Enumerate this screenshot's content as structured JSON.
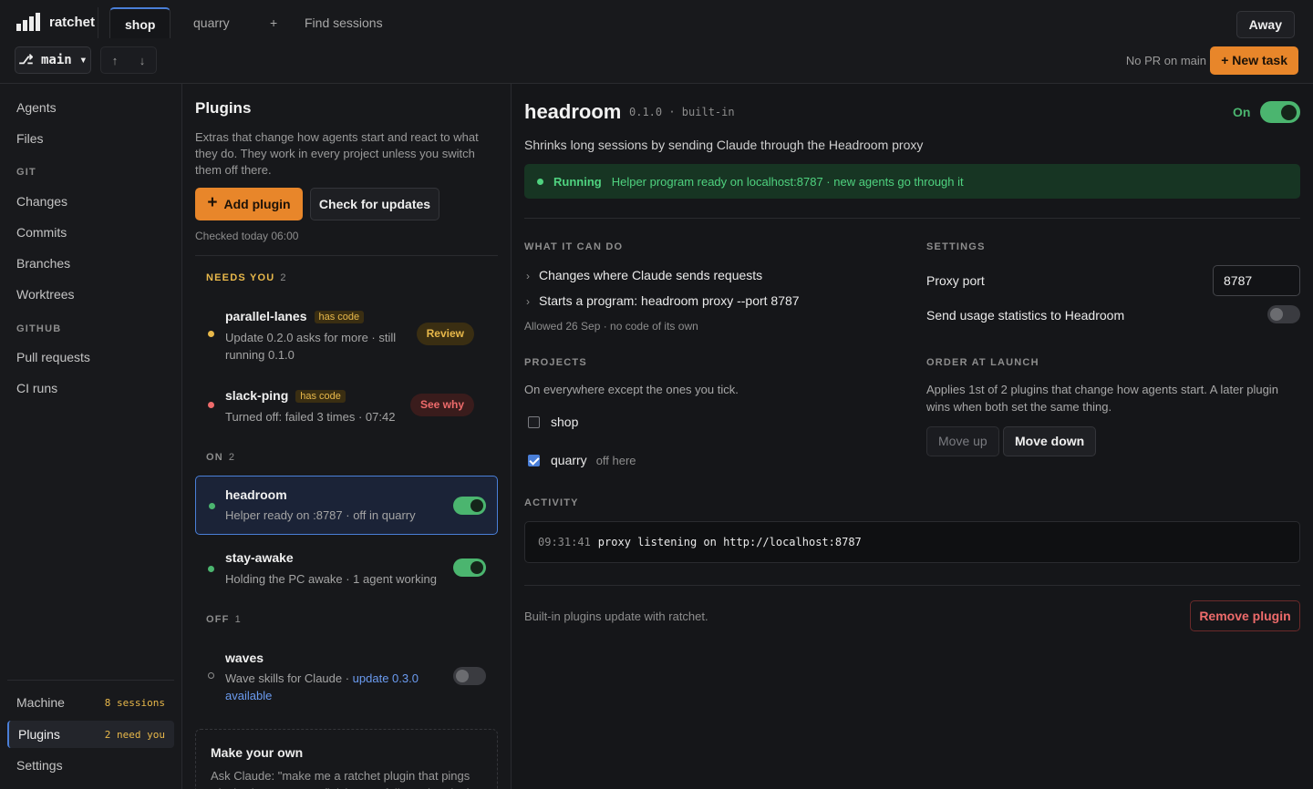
{
  "app": {
    "name": "ratchet"
  },
  "topbar": {
    "tabs": [
      {
        "label": "shop",
        "active": true
      },
      {
        "label": "quarry",
        "active": false
      },
      {
        "label": "+",
        "active": false
      },
      {
        "label": "Find sessions",
        "active": false
      }
    ],
    "status_button": "Away",
    "branch": "⎇ main ▾",
    "pr_status": "No PR on main",
    "new_task_label": "+ New task"
  },
  "sidebar": {
    "items_top": [
      "Agents",
      "Files"
    ],
    "git_heading": "GIT",
    "git_items": [
      "Changes",
      "Commits",
      "Branches",
      "Worktrees"
    ],
    "github_heading": "GITHUB",
    "github_items": [
      "Pull requests",
      "CI runs"
    ],
    "bottom": [
      {
        "label": "Machine",
        "count": "8 sessions",
        "active": false
      },
      {
        "label": "Plugins",
        "count": "2 need you",
        "active": true
      },
      {
        "label": "Settings",
        "count": "",
        "active": false
      }
    ]
  },
  "plugins_list": {
    "title": "Plugins",
    "description": "Extras that change how agents start and react to what they do. They work in every project unless you switch them off there.",
    "add_button": "Add plugin",
    "check_button": "Check for updates",
    "last_checked": "Checked today 06:00",
    "needs_you": {
      "heading": "NEEDS YOU",
      "count": "2"
    },
    "on": {
      "heading": "ON",
      "count": "2"
    },
    "off": {
      "heading": "OFF",
      "count": "1"
    },
    "items": {
      "parallel_lanes": {
        "name": "parallel-lanes",
        "badge": "has code",
        "sub": "Update 0.2.0 asks for more · still running 0.1.0",
        "action": "Review"
      },
      "slack_ping": {
        "name": "slack-ping",
        "badge": "has code",
        "sub": "Turned off: failed 3 times · 07:42",
        "action": "See why"
      },
      "headroom": {
        "name": "headroom",
        "sub": "Helper ready on :8787 · off in quarry",
        "enabled": true
      },
      "stay_awake": {
        "name": "stay-awake",
        "sub": "Holding the PC awake · 1 agent working",
        "enabled": true
      },
      "waves": {
        "name": "waves",
        "sub": "Wave skills for Claude · ",
        "update_link": "update 0.3.0 available",
        "enabled": false
      }
    },
    "make_your_own": {
      "title": "Make your own",
      "text": "Ask Claude: \"make me a ratchet plugin that pings Slack when an agent finishes\". It follows the plugin"
    }
  },
  "detail": {
    "name": "headroom",
    "version": "0.1.0 · built-in",
    "on_label": "On",
    "enabled": true,
    "description": "Shrinks long sessions by sending Claude through the Headroom proxy",
    "status": {
      "state": "Running",
      "message": "Helper program ready on localhost:8787 · new agents go through it"
    },
    "what_it_can_do": {
      "heading": "WHAT IT CAN DO",
      "items": [
        "Changes where Claude sends requests",
        "Starts a program: headroom proxy --port 8787"
      ],
      "note": "Allowed 26 Sep · no code of its own"
    },
    "settings": {
      "heading": "SETTINGS",
      "proxy_port_label": "Proxy port",
      "proxy_port_value": "8787",
      "usage_stats_label": "Send usage statistics to Headroom",
      "usage_stats_enabled": false
    },
    "projects": {
      "heading": "PROJECTS",
      "description": "On everywhere except the ones you tick.",
      "items": [
        {
          "name": "shop",
          "checked": false,
          "note": ""
        },
        {
          "name": "quarry",
          "checked": true,
          "note": "off here"
        }
      ]
    },
    "order": {
      "heading": "ORDER AT LAUNCH",
      "text": "Applies 1st of 2 plugins that change how agents start. A later plugin wins when both set the same thing.",
      "move_up": "Move up",
      "move_down": "Move down"
    },
    "activity": {
      "heading": "ACTIVITY",
      "log": [
        {
          "time": "09:31:41",
          "message": "proxy listening on http://localhost:8787"
        }
      ]
    },
    "footer_note": "Built-in plugins update with ratchet.",
    "remove_button": "Remove plugin"
  }
}
